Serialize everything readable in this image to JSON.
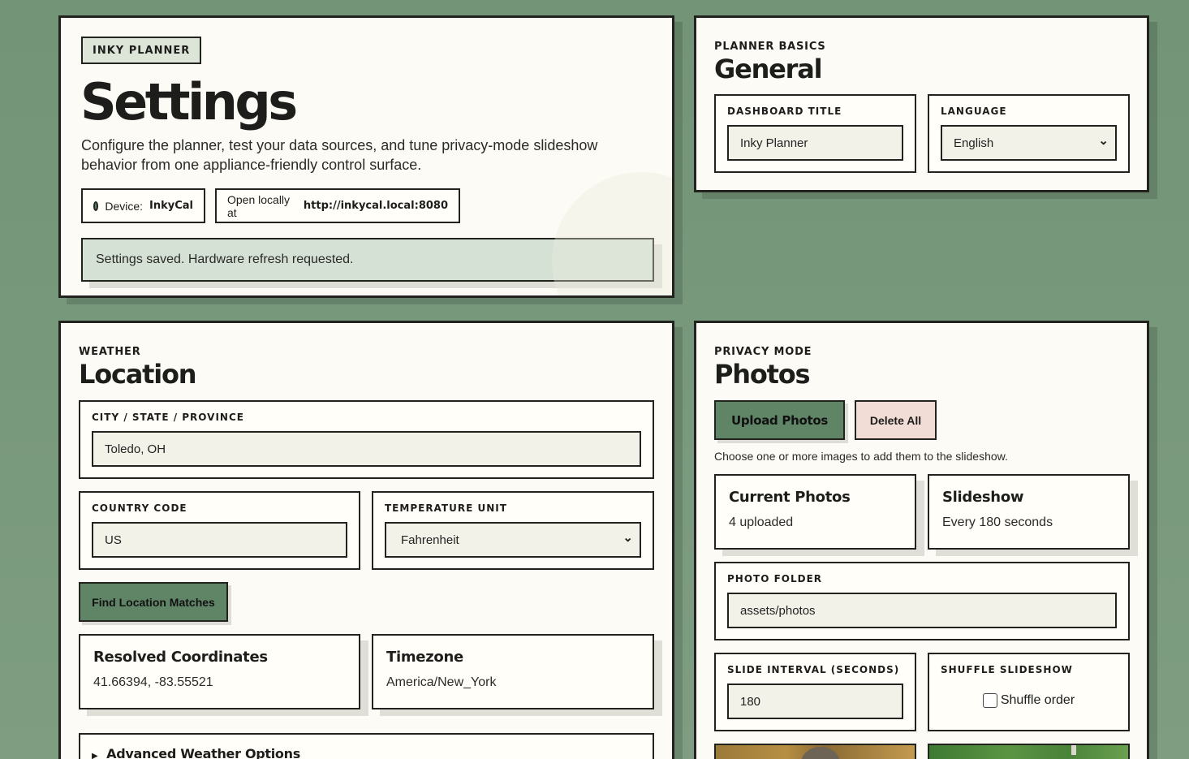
{
  "header": {
    "badge": "INKY PLANNER",
    "title": "Settings",
    "description": "Configure the planner, test your data sources, and tune privacy-mode slideshow behavior from one appliance-friendly control surface.",
    "device_label": "Device:",
    "device_name": "InkyCal",
    "open_label": "Open locally at",
    "open_url": "http://inkycal.local:8080",
    "status_message": "Settings saved. Hardware refresh requested."
  },
  "general": {
    "kicker": "PLANNER BASICS",
    "title": "General",
    "dashboard_title_label": "DASHBOARD TITLE",
    "dashboard_title_value": "Inky Planner",
    "language_label": "LANGUAGE",
    "language_value": "English"
  },
  "location": {
    "kicker": "WEATHER",
    "title": "Location",
    "city_label": "CITY / STATE / PROVINCE",
    "city_value": "Toledo, OH",
    "country_label": "COUNTRY CODE",
    "country_value": "US",
    "temp_label": "TEMPERATURE UNIT",
    "temp_value": "Fahrenheit",
    "find_button": "Find Location Matches",
    "coords_title": "Resolved Coordinates",
    "coords_value": "41.66394, -83.55521",
    "tz_title": "Timezone",
    "tz_value": "America/New_York",
    "advanced_label": "Advanced Weather Options"
  },
  "photos": {
    "kicker": "PRIVACY MODE",
    "title": "Photos",
    "upload_button": "Upload Photos",
    "delete_button": "Delete All",
    "hint": "Choose one or more images to add them to the slideshow.",
    "current_title": "Current Photos",
    "current_value": "4 uploaded",
    "slideshow_title": "Slideshow",
    "slideshow_value": "Every 180 seconds",
    "folder_label": "PHOTO FOLDER",
    "folder_value": "assets/photos",
    "interval_label": "SLIDE INTERVAL (SECONDS)",
    "interval_value": "180",
    "shuffle_label": "SHUFFLE SLIDESHOW",
    "shuffle_option": "Shuffle order",
    "shuffle_checked": false
  },
  "colors": {
    "background": "#769679",
    "card": "#fcfbf5",
    "accent_green": "#5f8466",
    "danger_pink": "#f2dcd6",
    "status_bg": "#d6e1d6"
  }
}
